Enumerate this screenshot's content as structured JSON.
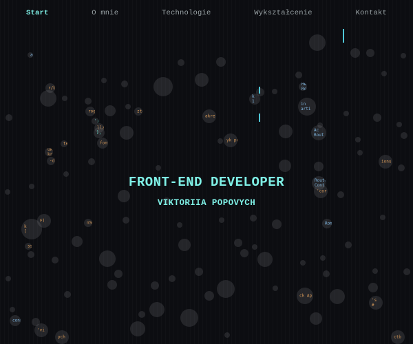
{
  "nav": {
    "items": [
      {
        "label": "Start",
        "active": true
      },
      {
        "label": "O mnie",
        "active": false
      },
      {
        "label": "Technologie",
        "active": false
      },
      {
        "label": "Wykształcenie",
        "active": false
      },
      {
        "label": "Kontakt",
        "active": false
      }
    ]
  },
  "hero": {
    "title": "FRONT-END DEVELOPER",
    "name": "VIKTORIIA POPOVYCH"
  },
  "colors": {
    "accent": "#7ff0e6",
    "background": "#0c0d11",
    "nav_text": "#9aa3a6"
  }
}
